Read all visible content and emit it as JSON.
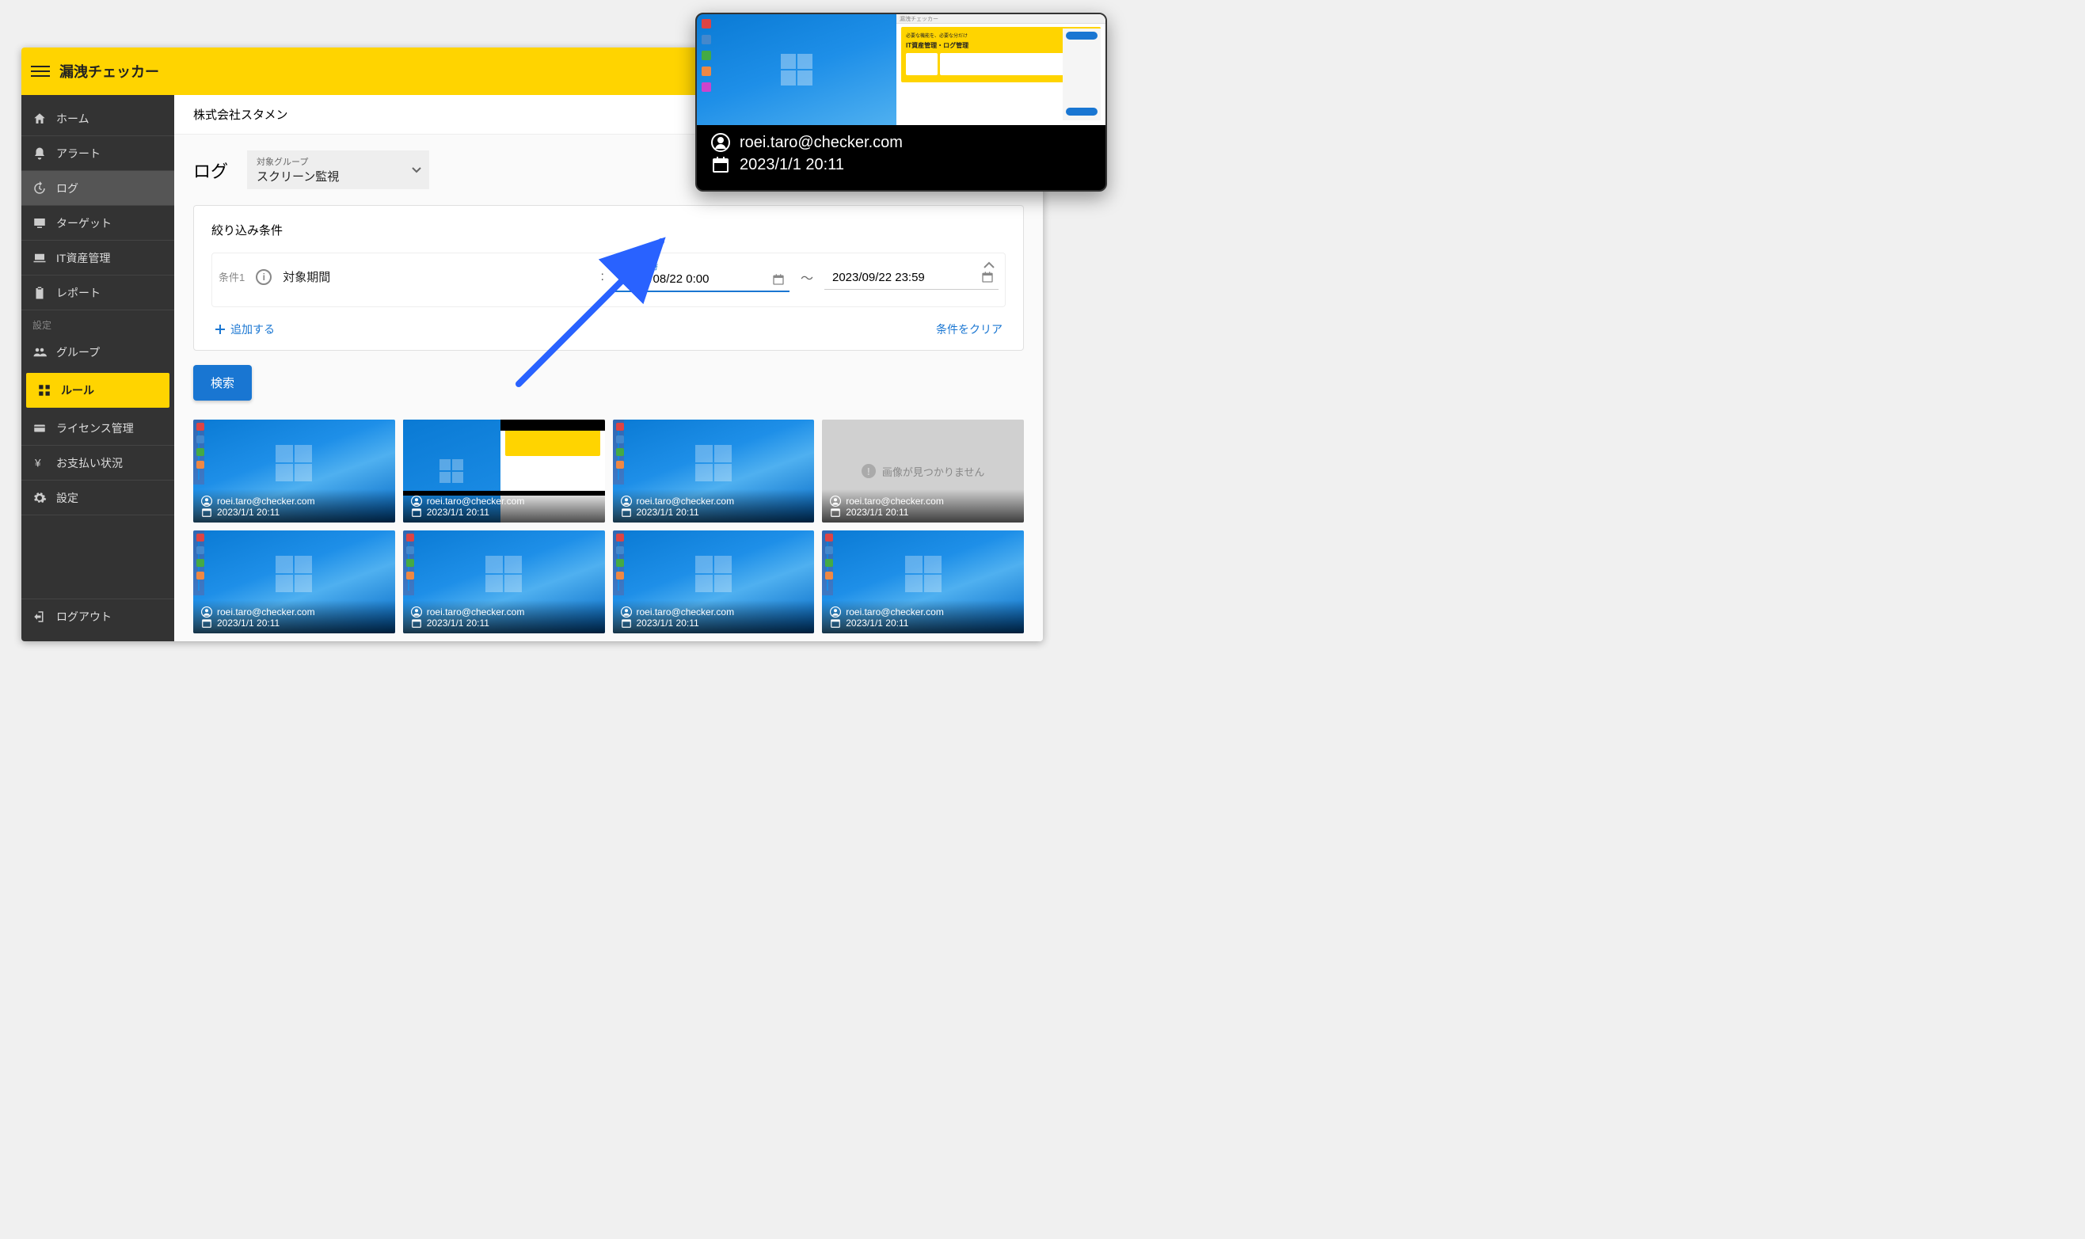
{
  "app_title": "漏洩チェッカー",
  "header": {
    "company": "株式会社スタメン"
  },
  "sidebar": {
    "items": [
      {
        "label": "ホーム"
      },
      {
        "label": "アラート"
      },
      {
        "label": "ログ"
      },
      {
        "label": "ターゲット"
      },
      {
        "label": "IT資産管理"
      },
      {
        "label": "レポート"
      }
    ],
    "settings_label": "設定",
    "settings_items": [
      {
        "label": "グループ"
      },
      {
        "label": "ルール"
      },
      {
        "label": "ライセンス管理"
      },
      {
        "label": "お支払い状況"
      },
      {
        "label": "設定"
      }
    ],
    "logout": "ログアウト"
  },
  "page": {
    "title": "ログ",
    "group_select": {
      "label": "対象グループ",
      "value": "スクリーン監視"
    },
    "filter": {
      "title": "絞り込み条件",
      "cond_label": "条件1",
      "cond_name": "対象期間",
      "start_label": "開始日時",
      "start_value": "2023/08/22 0:00",
      "end_value": "2023/09/22 23:59",
      "add_label": "追加する",
      "clear_label": "条件をクリア"
    },
    "search_label": "検索",
    "not_found_text": "画像が見つかりません",
    "results": [
      {
        "user": "roei.taro@checker.com",
        "time": "2023/1/1 20:11",
        "kind": "desktop"
      },
      {
        "user": "roei.taro@checker.com",
        "time": "2023/1/1 20:11",
        "kind": "split"
      },
      {
        "user": "roei.taro@checker.com",
        "time": "2023/1/1 20:11",
        "kind": "desktop"
      },
      {
        "user": "roei.taro@checker.com",
        "time": "2023/1/1 20:11",
        "kind": "notfound"
      },
      {
        "user": "roei.taro@checker.com",
        "time": "2023/1/1 20:11",
        "kind": "desktop"
      },
      {
        "user": "roei.taro@checker.com",
        "time": "2023/1/1 20:11",
        "kind": "desktop"
      },
      {
        "user": "roei.taro@checker.com",
        "time": "2023/1/1 20:11",
        "kind": "desktop"
      },
      {
        "user": "roei.taro@checker.com",
        "time": "2023/1/1 20:11",
        "kind": "desktop"
      }
    ]
  },
  "popup": {
    "user": "roei.taro@checker.com",
    "time": "2023/1/1 20:11",
    "banner_line1": "必要な機能を、必要な分だけ",
    "banner_line2": "IT資産管理・ログ管理"
  }
}
